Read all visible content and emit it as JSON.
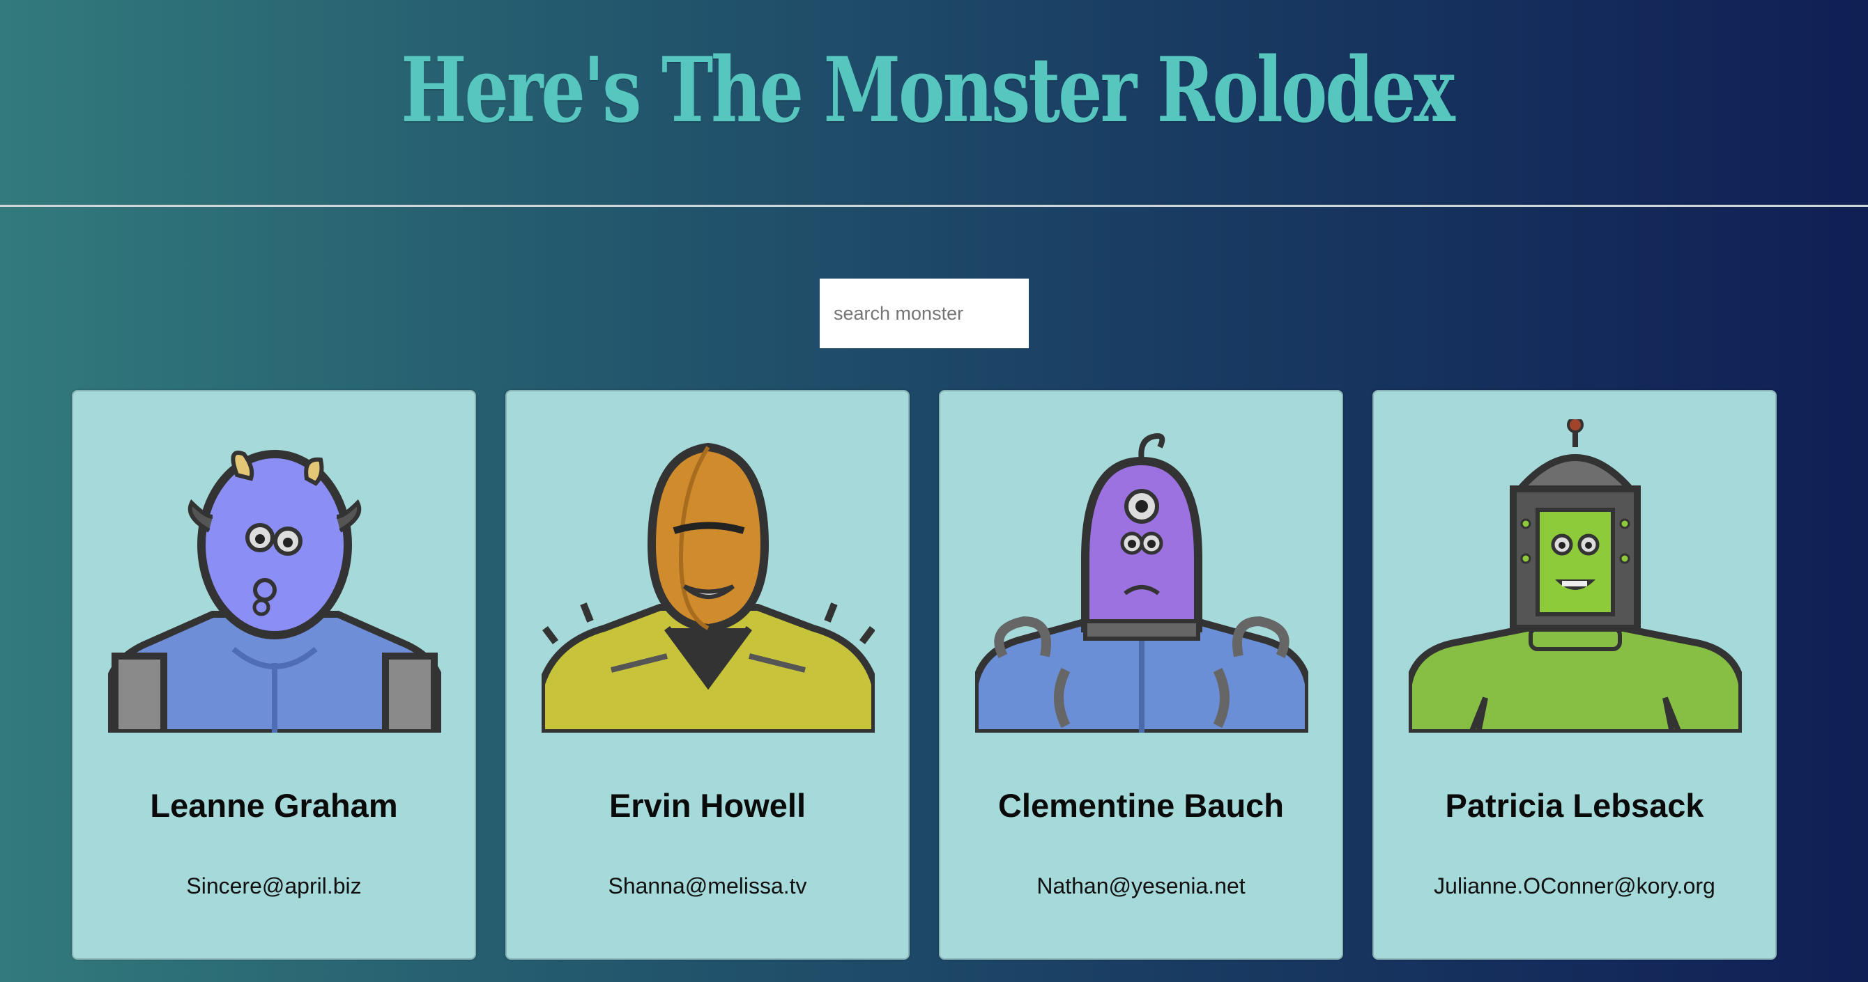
{
  "header": {
    "title": "Here's The Monster Rolodex"
  },
  "search": {
    "placeholder": "search monster",
    "value": ""
  },
  "monsters": [
    {
      "name": "Leanne Graham",
      "email": "Sincere@april.biz",
      "color": "#8b8ef5",
      "body_color": "#6e8ed8",
      "avatar": "horned-blue-monster"
    },
    {
      "name": "Ervin Howell",
      "email": "Shanna@melissa.tv",
      "color": "#cf8b2c",
      "body_color": "#c7c43c",
      "avatar": "golden-masked-monster"
    },
    {
      "name": "Clementine Bauch",
      "email": "Nathan@yesenia.net",
      "color": "#9c72e0",
      "body_color": "#6b8fd6",
      "avatar": "purple-cyclops-monster"
    },
    {
      "name": "Patricia Lebsack",
      "email": "Julianne.OConner@kory.org",
      "color": "#8ecb3a",
      "body_color": "#87bf45",
      "avatar": "green-robot-monster"
    }
  ]
}
